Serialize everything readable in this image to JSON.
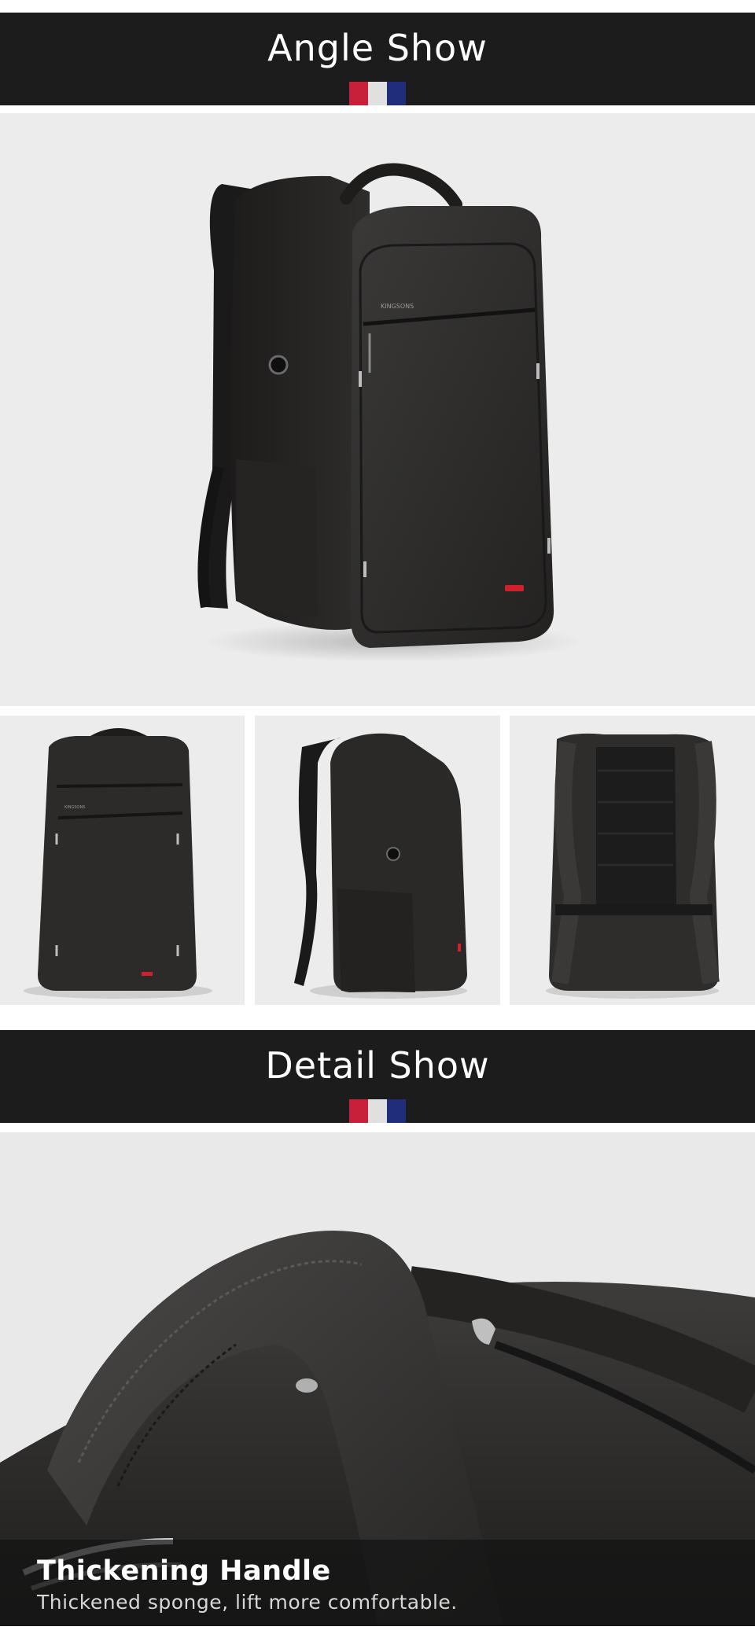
{
  "sections": {
    "angle": {
      "title": "Angle Show"
    },
    "detail": {
      "title": "Detail Show"
    }
  },
  "flag_colors": [
    "#c8203a",
    "#e0e0e0",
    "#1f2d7a"
  ],
  "brand_logo": "KINGSONS",
  "feature": {
    "title": "Thickening Handle",
    "subtitle": "Thickened sponge, lift more comfortable."
  },
  "colors": {
    "banner_bg": "#1c1c1c",
    "photo_bg": "#ececec",
    "bag": "#2b2a29",
    "accent_red": "#d0202a"
  }
}
